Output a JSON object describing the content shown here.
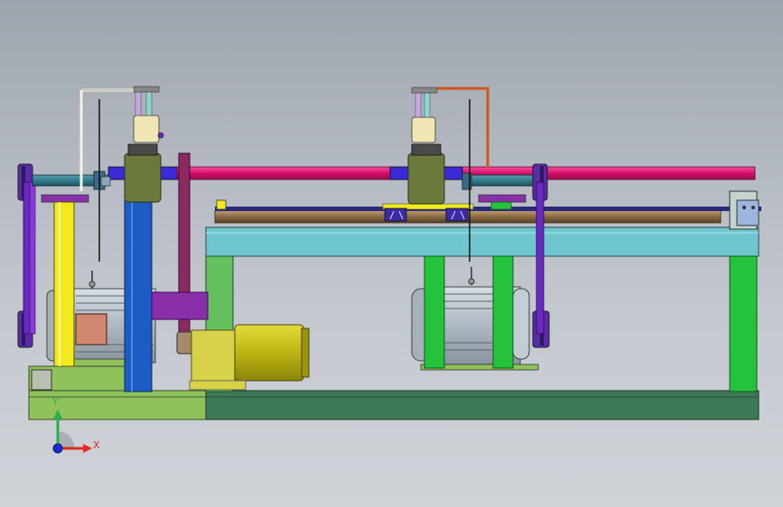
{
  "scene": {
    "colors": {
      "base_left": "#8fc25a",
      "base_right": "#3c7a55",
      "table_top": "#6fc6cf",
      "leg_green": "#25c23b",
      "yellow_upright": "#f3ea1e",
      "blue_upright": "#1c5cc4",
      "magenta_shaft": "#e11c7a",
      "purple": "#8a2faa",
      "olive_block": "#6b7a3c",
      "motor_body": "#b8c3cc",
      "motor_yellow": "#c8c21a",
      "belt": "#5a2aa8"
    }
  },
  "triad": {
    "x_label": "X",
    "y_label": "Y"
  }
}
